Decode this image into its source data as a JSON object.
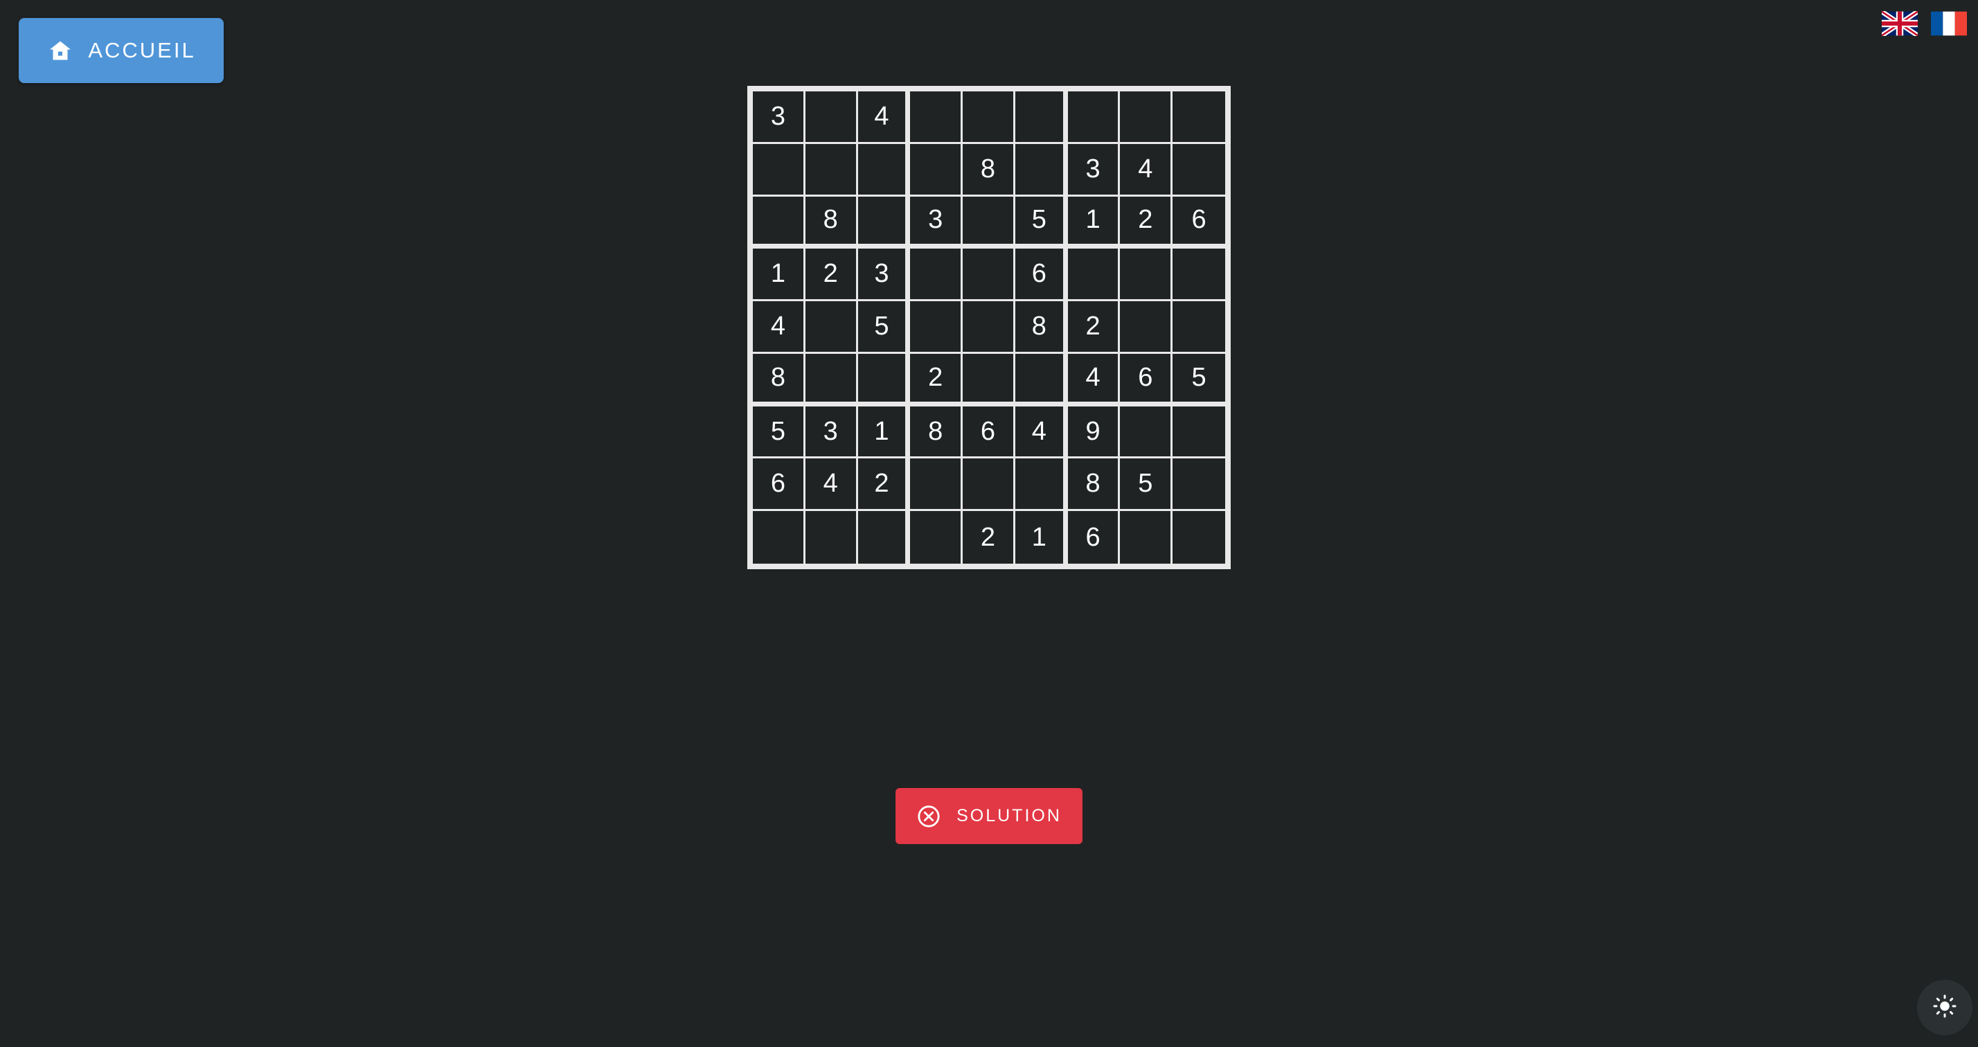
{
  "header": {
    "home_label": "ACCUEIL",
    "home_icon": "home-icon"
  },
  "languages": [
    {
      "code": "en",
      "icon": "uk-flag-icon"
    },
    {
      "code": "fr",
      "icon": "france-flag-icon"
    }
  ],
  "board": {
    "rows": [
      [
        "3",
        "",
        "4",
        "",
        "",
        "",
        "",
        "",
        ""
      ],
      [
        "",
        "",
        "",
        "",
        "8",
        "",
        "3",
        "4",
        ""
      ],
      [
        "",
        "8",
        "",
        "3",
        "",
        "5",
        "1",
        "2",
        "6"
      ],
      [
        "1",
        "2",
        "3",
        "",
        "",
        "6",
        "",
        "",
        ""
      ],
      [
        "4",
        "",
        "5",
        "",
        "",
        "8",
        "2",
        "",
        ""
      ],
      [
        "8",
        "",
        "",
        "2",
        "",
        "",
        "4",
        "6",
        "5"
      ],
      [
        "5",
        "3",
        "1",
        "8",
        "6",
        "4",
        "9",
        "",
        ""
      ],
      [
        "6",
        "4",
        "2",
        "",
        "",
        "",
        "8",
        "5",
        ""
      ],
      [
        "",
        "",
        "",
        "",
        "2",
        "1",
        "6",
        "",
        ""
      ]
    ]
  },
  "actions": {
    "solution_label": "SOLUTION",
    "solution_icon": "close-circle-icon"
  },
  "theme_toggle_icon": "sun-icon",
  "colors": {
    "background": "#1f2324",
    "home_button": "#4f95d8",
    "solution_button": "#e23744",
    "grid_lines": "#e8e8e8"
  }
}
